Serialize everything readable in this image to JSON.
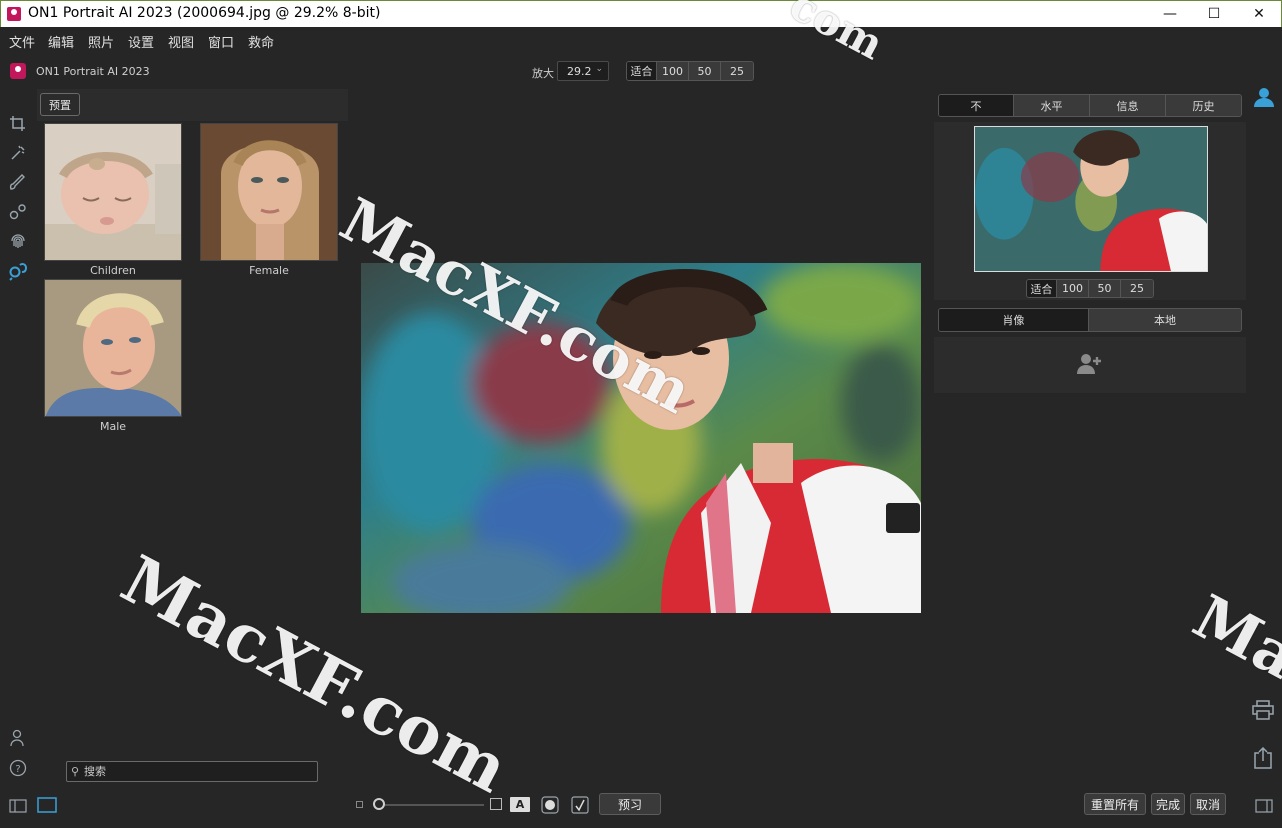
{
  "window": {
    "title": "ON1 Portrait AI 2023 (2000694.jpg @ 29.2% 8-bit)",
    "minimize": "—",
    "maximize": "☐",
    "close": "✕"
  },
  "menu": [
    "文件",
    "编辑",
    "照片",
    "设置",
    "视图",
    "窗口",
    "救命"
  ],
  "app": {
    "brand": "ON1 Portrait AI 2023",
    "zoom_label": "放大",
    "zoom_value": "29.2",
    "zoom_presets": [
      "适合",
      "100",
      "50",
      "25"
    ]
  },
  "left_tools": [
    "crop-icon",
    "retouch-brush-icon",
    "paint-brush-icon",
    "clone-icon",
    "fingerprint-icon",
    "face-search-icon"
  ],
  "presets": {
    "button": "预置",
    "items": [
      {
        "label": "Children"
      },
      {
        "label": "Female"
      },
      {
        "label": "Male"
      }
    ]
  },
  "search": {
    "placeholder": "搜索"
  },
  "right_panel": {
    "tabs": [
      "不",
      "水平",
      "信息",
      "历史"
    ],
    "nav_zoom": [
      "适合",
      "100",
      "50",
      "25"
    ],
    "sub_tabs": [
      "肖像",
      "本地"
    ]
  },
  "bottom": {
    "preview": "预习",
    "reset_all": "重置所有",
    "done": "完成",
    "cancel": "取消",
    "compare_letter": "A"
  },
  "watermarks": [
    "MacXF.com",
    "MacXF.com",
    "Ma",
    "com"
  ],
  "colors": {
    "accent": "#3aa0d8",
    "brand": "#c2185b",
    "background": "#262626"
  }
}
